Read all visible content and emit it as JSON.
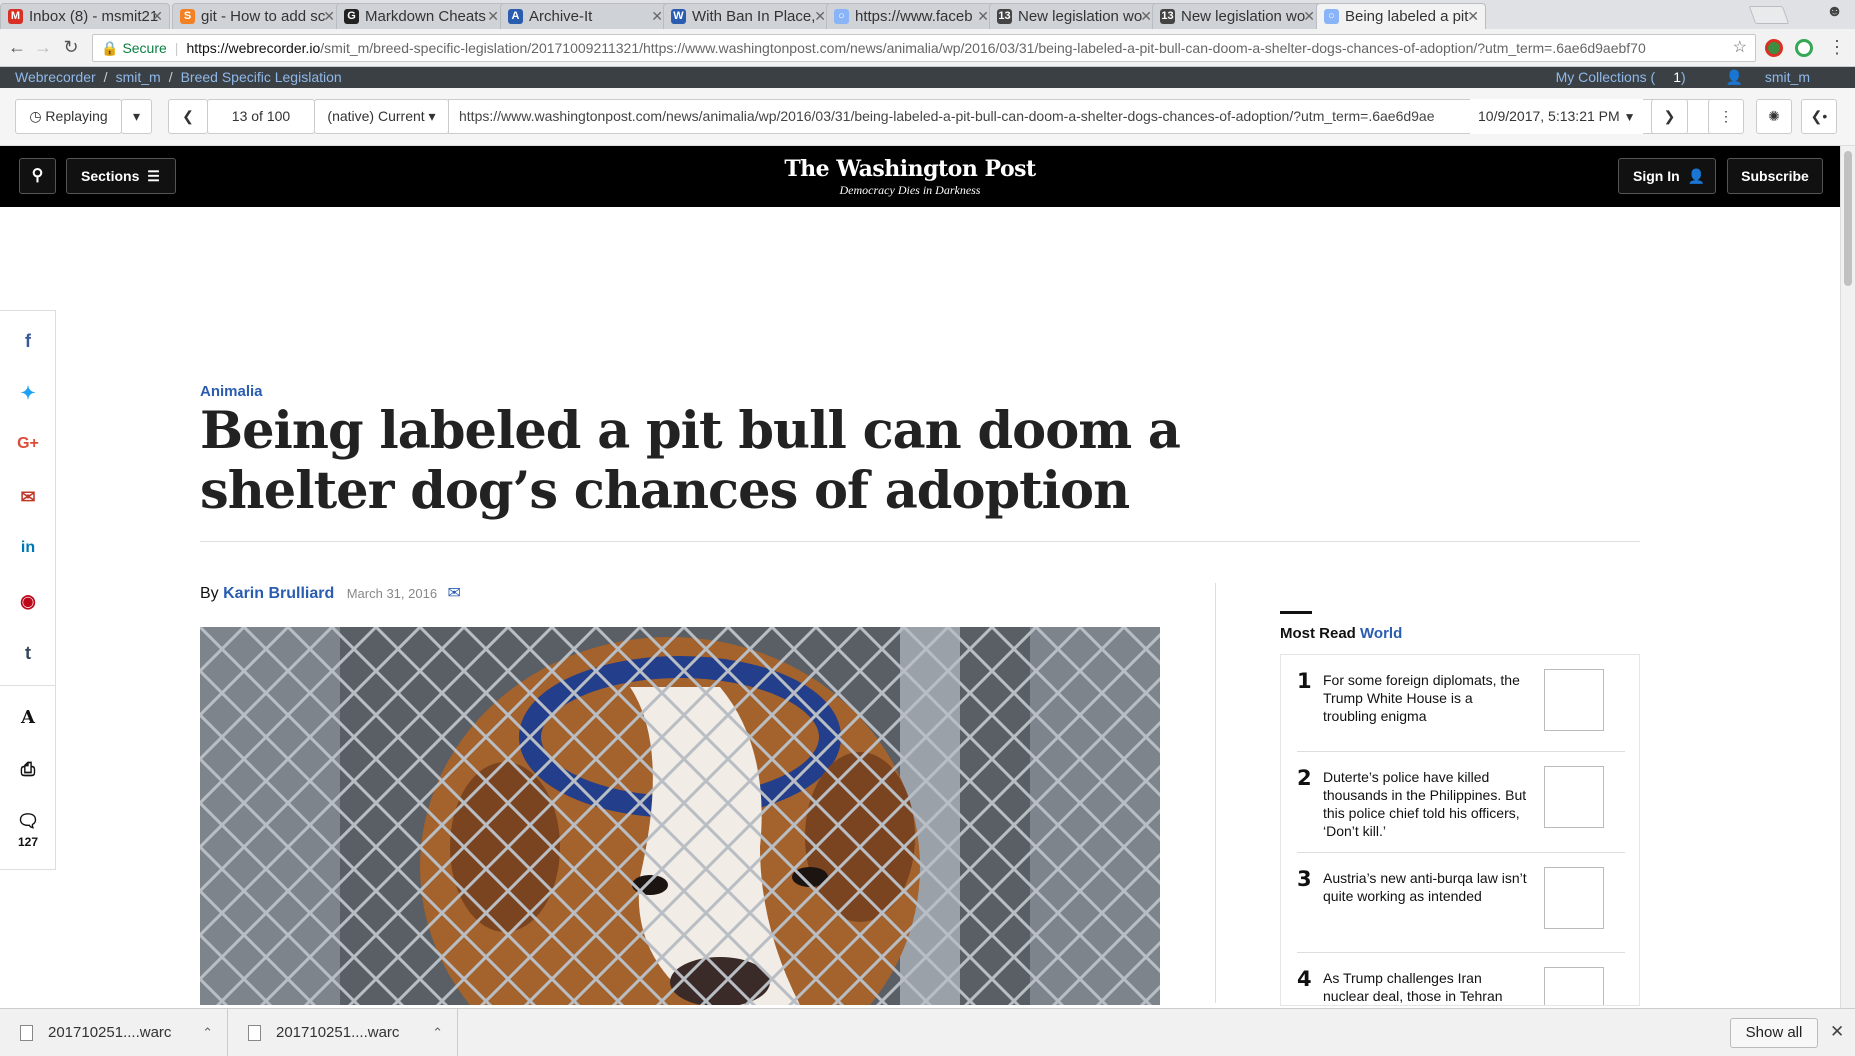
{
  "browser": {
    "tabs": [
      {
        "title": "Inbox (8) - msmit21",
        "icon": "gmail-icon",
        "color": "#d93025",
        "glyph": "M"
      },
      {
        "title": "git - How to add sc",
        "icon": "stackoverflow-icon",
        "color": "#f48024",
        "glyph": "S"
      },
      {
        "title": "Markdown Cheats",
        "icon": "github-icon",
        "color": "#222222",
        "glyph": "G"
      },
      {
        "title": "Archive-It",
        "icon": "archive-it-icon",
        "color": "#2a5db0",
        "glyph": "A"
      },
      {
        "title": "With Ban In Place,",
        "icon": "site-icon",
        "color": "#2a5db0",
        "glyph": "W"
      },
      {
        "title": "https://www.faceb",
        "icon": "globe-icon",
        "color": "#8ab4f8",
        "glyph": "○"
      },
      {
        "title": "New legislation wo",
        "icon": "calendar-icon",
        "color": "#444444",
        "glyph": "13"
      },
      {
        "title": "New legislation wo",
        "icon": "calendar-icon",
        "color": "#444444",
        "glyph": "13"
      },
      {
        "title": "Being labeled a pit",
        "icon": "globe-icon",
        "color": "#8ab4f8",
        "glyph": "○",
        "active": true
      }
    ],
    "url_secure_label": "Secure",
    "url_host": "https://webrecorder.io",
    "url_rest": "/smit_m/breed-specific-legislation/20171009211321/https://www.washingtonpost.com/news/animalia/wp/2016/03/31/being-labeled-a-pit-bull-can-doom-a-shelter-dogs-chances-of-adoption/?utm_term=.6ae6d9aebf70"
  },
  "webrecorder": {
    "crumbs": [
      "Webrecorder",
      "smit_m",
      "Breed Specific Legislation"
    ],
    "my_collections": "My Collections",
    "collections_count": "1",
    "user": "smit_m",
    "replaying_label": "Replaying",
    "page_counter": "13 of 100",
    "browser_mode": "(native) Current",
    "replay_url": "https://www.washingtonpost.com/news/animalia/wp/2016/03/31/being-labeled-a-pit-bull-can-doom-a-shelter-dogs-chances-of-adoption/?utm_term=.6ae6d9ae",
    "capture_date": "10/9/2017, 5:13:21 PM"
  },
  "site": {
    "sections_label": "Sections",
    "logo_name": "The Washington Post",
    "logo_tagline": "Democracy Dies in Darkness",
    "sign_in_label": "Sign In",
    "subscribe_label": "Subscribe"
  },
  "share": {
    "comment_count": "127"
  },
  "article": {
    "kicker": "Animalia",
    "headline": "Being labeled a pit bull can doom a shelter dog’s chances of adoption",
    "by_label": "By",
    "author": "Karin Brulliard",
    "date": "March 31, 2016"
  },
  "most_read": {
    "label": "Most Read",
    "section": "World",
    "items": [
      {
        "num": "1",
        "text": "For some foreign diplomats, the Trump White House is a troubling enigma"
      },
      {
        "num": "2",
        "text": "Duterte’s police have killed thousands in the Philippines. But this police chief told his officers, ‘Don’t kill.’"
      },
      {
        "num": "3",
        "text": "Austria’s new anti-burqa law isn’t quite working as intended"
      },
      {
        "num": "4",
        "text": "As Trump challenges Iran nuclear deal, those in Tehran worry"
      }
    ]
  },
  "downloads": {
    "files": [
      "201710251....warc",
      "201710251....warc"
    ],
    "show_all_label": "Show all"
  }
}
